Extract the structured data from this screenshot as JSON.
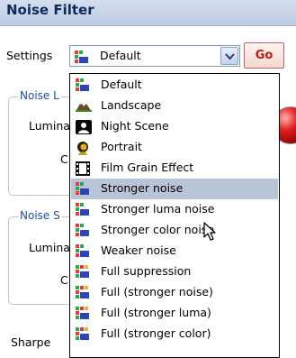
{
  "title": "Noise Filter",
  "settings": {
    "label": "Settings",
    "selected": "Default",
    "go_label": "Go"
  },
  "groups": [
    {
      "title": "Noise L",
      "luma_label": "Lumina",
      "c_label": "C"
    },
    {
      "title": "Noise S",
      "luma_label": "Lumina",
      "c_label": "C"
    }
  ],
  "sharpen_label": "Sharpe",
  "dropdown": {
    "items": [
      {
        "label": "Default",
        "icon": "preset-icon"
      },
      {
        "label": "Landscape",
        "icon": "landscape-icon"
      },
      {
        "label": "Night Scene",
        "icon": "night-scene-icon"
      },
      {
        "label": "Portrait",
        "icon": "portrait-icon"
      },
      {
        "label": "Film Grain Effect",
        "icon": "film-strip-icon"
      },
      {
        "label": "Stronger noise",
        "icon": "preset-icon"
      },
      {
        "label": "Stronger luma noise",
        "icon": "preset-icon"
      },
      {
        "label": "Stronger color noise",
        "icon": "preset-icon"
      },
      {
        "label": "Weaker noise",
        "icon": "preset-icon"
      },
      {
        "label": "Full suppression",
        "icon": "full-preset-icon"
      },
      {
        "label": "Full (stronger noise)",
        "icon": "full-preset-icon"
      },
      {
        "label": "Full (stronger luma)",
        "icon": "full-preset-icon"
      },
      {
        "label": "Full (stronger color)",
        "icon": "full-preset-icon"
      }
    ],
    "highlighted": "Stronger noise"
  },
  "colors": {
    "highlight": "#b9c4d6",
    "go_text": "#c01818",
    "group_title": "#1f4ea3"
  }
}
